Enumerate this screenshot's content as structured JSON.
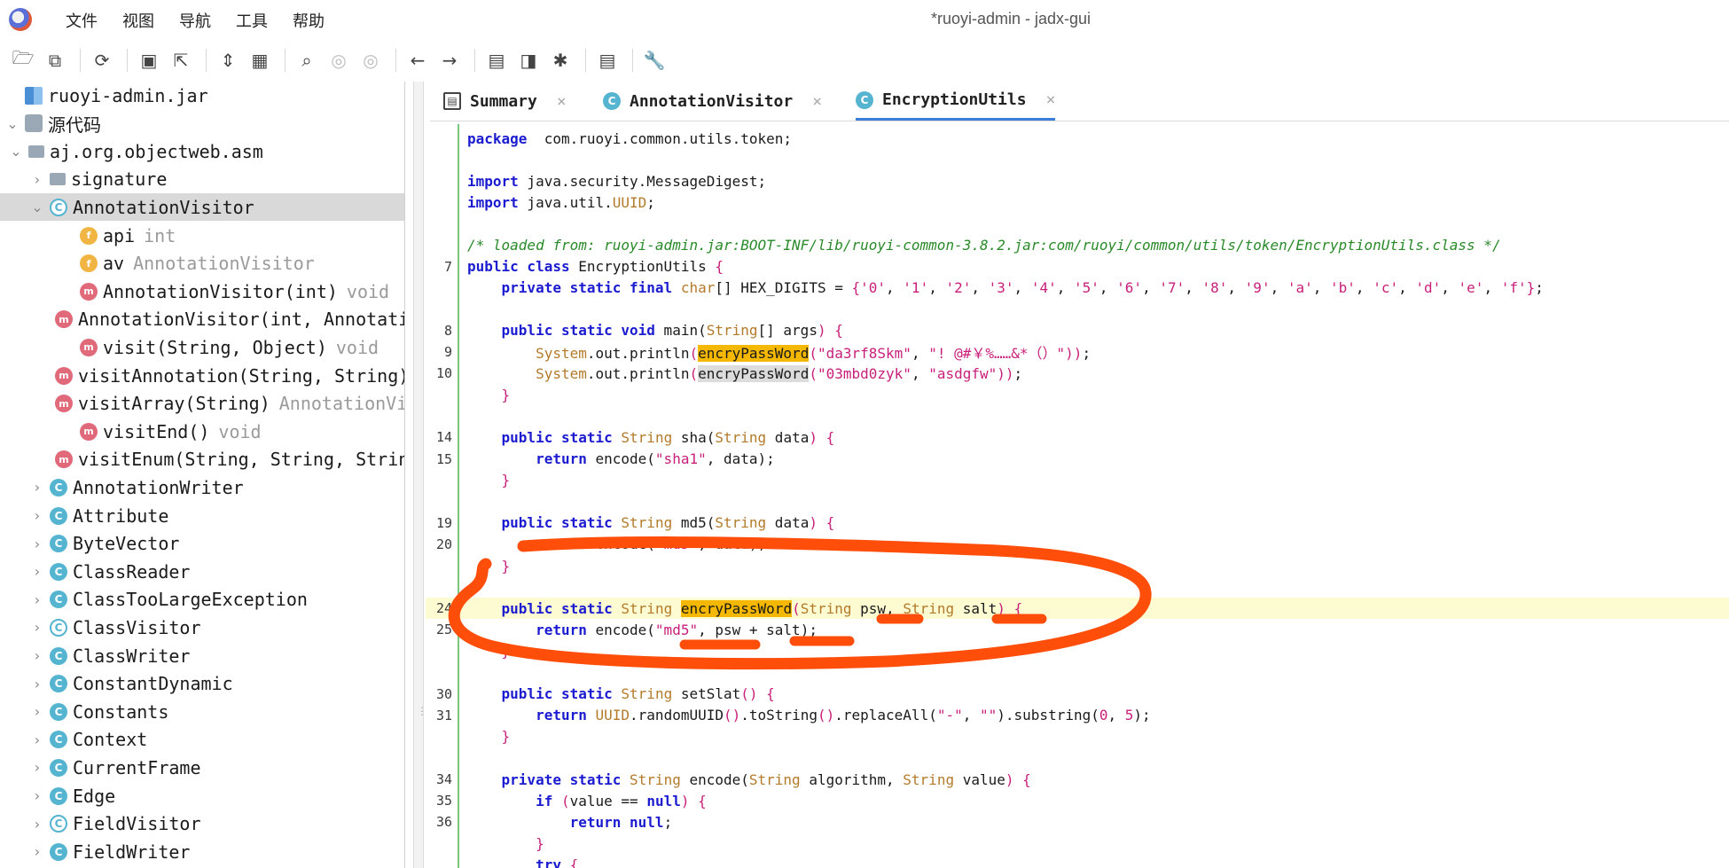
{
  "window": {
    "title": "*ruoyi-admin - jadx-gui"
  },
  "menu": [
    "文件",
    "视图",
    "导航",
    "工具",
    "帮助"
  ],
  "toolbar": [
    {
      "icon": "open-folder-icon",
      "g": "🗁"
    },
    {
      "icon": "add-files-icon",
      "g": "⧉"
    },
    {
      "sep": true
    },
    {
      "icon": "reload-icon",
      "g": "⟳"
    },
    {
      "sep": true
    },
    {
      "icon": "save-icon",
      "g": "▣"
    },
    {
      "icon": "export-icon",
      "g": "⇱"
    },
    {
      "sep": true
    },
    {
      "icon": "sync-tree-icon",
      "g": "⇕"
    },
    {
      "icon": "flatten-packages-icon",
      "g": "▦"
    },
    {
      "sep": true
    },
    {
      "icon": "search-icon",
      "g": "⌕"
    },
    {
      "icon": "find-class-icon",
      "g": "◎",
      "gray": true
    },
    {
      "icon": "find-usage-icon",
      "g": "◎",
      "gray": true
    },
    {
      "sep": true
    },
    {
      "icon": "back-icon",
      "g": "←"
    },
    {
      "icon": "forward-icon",
      "g": "→"
    },
    {
      "sep": true
    },
    {
      "icon": "decompile-all-icon",
      "g": "▤"
    },
    {
      "icon": "quark-icon",
      "g": "◨"
    },
    {
      "icon": "debug-icon",
      "g": "✱"
    },
    {
      "sep": true
    },
    {
      "icon": "log-viewer-icon",
      "g": "▤"
    },
    {
      "sep": true
    },
    {
      "icon": "settings-icon",
      "g": "🔧"
    }
  ],
  "tree": [
    {
      "depth": 0,
      "chev": "",
      "icon": "jar",
      "label": "ruoyi-admin.jar"
    },
    {
      "depth": 0,
      "chev": "v",
      "icon": "src",
      "label": "源代码"
    },
    {
      "depth": 1,
      "chev": "v",
      "icon": "pkg",
      "label": "aj.org.objectweb.asm"
    },
    {
      "depth": 2,
      "chev": ">",
      "icon": "pkg",
      "label": "signature"
    },
    {
      "depth": 2,
      "chev": "v",
      "icon": "class-abs",
      "label": "AnnotationVisitor",
      "selected": true
    },
    {
      "depth": 3,
      "chev": "",
      "icon": "field",
      "label": "api",
      "type": "int"
    },
    {
      "depth": 3,
      "chev": "",
      "icon": "field",
      "label": "av",
      "type": "AnnotationVisitor"
    },
    {
      "depth": 3,
      "chev": "",
      "icon": "method",
      "label": "AnnotationVisitor(int)",
      "type": "void"
    },
    {
      "depth": 3,
      "chev": "",
      "icon": "method",
      "label": "AnnotationVisitor(int, AnnotationVisitor)",
      "type": ""
    },
    {
      "depth": 3,
      "chev": "",
      "icon": "method",
      "label": "visit(String, Object)",
      "type": "void"
    },
    {
      "depth": 3,
      "chev": "",
      "icon": "method",
      "label": "visitAnnotation(String, String)",
      "type": ""
    },
    {
      "depth": 3,
      "chev": "",
      "icon": "method",
      "label": "visitArray(String)",
      "type": "AnnotationVisitor"
    },
    {
      "depth": 3,
      "chev": "",
      "icon": "method",
      "label": "visitEnd()",
      "type": "void"
    },
    {
      "depth": 3,
      "chev": "",
      "icon": "method",
      "label": "visitEnum(String, String, String)",
      "type": ""
    },
    {
      "depth": 2,
      "chev": ">",
      "icon": "class",
      "label": "AnnotationWriter"
    },
    {
      "depth": 2,
      "chev": ">",
      "icon": "class",
      "label": "Attribute"
    },
    {
      "depth": 2,
      "chev": ">",
      "icon": "class",
      "label": "ByteVector"
    },
    {
      "depth": 2,
      "chev": ">",
      "icon": "class",
      "label": "ClassReader"
    },
    {
      "depth": 2,
      "chev": ">",
      "icon": "class",
      "label": "ClassTooLargeException"
    },
    {
      "depth": 2,
      "chev": ">",
      "icon": "class-abs",
      "label": "ClassVisitor"
    },
    {
      "depth": 2,
      "chev": ">",
      "icon": "class",
      "label": "ClassWriter"
    },
    {
      "depth": 2,
      "chev": ">",
      "icon": "class",
      "label": "ConstantDynamic"
    },
    {
      "depth": 2,
      "chev": ">",
      "icon": "class",
      "label": "Constants"
    },
    {
      "depth": 2,
      "chev": ">",
      "icon": "class",
      "label": "Context"
    },
    {
      "depth": 2,
      "chev": ">",
      "icon": "class",
      "label": "CurrentFrame"
    },
    {
      "depth": 2,
      "chev": ">",
      "icon": "class",
      "label": "Edge"
    },
    {
      "depth": 2,
      "chev": ">",
      "icon": "class-abs",
      "label": "FieldVisitor"
    },
    {
      "depth": 2,
      "chev": ">",
      "icon": "class",
      "label": "FieldWriter"
    }
  ],
  "tabs": [
    {
      "label": "Summary",
      "icon": "summary",
      "active": false
    },
    {
      "label": "AnnotationVisitor",
      "icon": "class",
      "active": false
    },
    {
      "label": "EncryptionUtils",
      "icon": "class",
      "active": true
    }
  ],
  "code": [
    {
      "ln": "",
      "segs": [
        [
          "kw",
          "package"
        ],
        [
          "",
          "  com.ruoyi.common.utils.token;"
        ]
      ]
    },
    {
      "ln": "",
      "segs": []
    },
    {
      "ln": "",
      "segs": [
        [
          "kw",
          "import"
        ],
        [
          "",
          " java.security.MessageDigest;"
        ]
      ]
    },
    {
      "ln": "",
      "segs": [
        [
          "kw",
          "import"
        ],
        [
          "",
          " java.util."
        ],
        [
          "ty",
          "UUID"
        ],
        [
          "",
          ";"
        ]
      ]
    },
    {
      "ln": "",
      "segs": []
    },
    {
      "ln": "",
      "segs": [
        [
          "cmt",
          "/* loaded from: ruoyi-admin.jar:BOOT-INF/lib/ruoyi-common-3.8.2.jar:com/ruoyi/common/utils/token/EncryptionUtils.class */"
        ]
      ]
    },
    {
      "ln": "7",
      "segs": [
        [
          "kw",
          "public class"
        ],
        [
          "",
          " EncryptionUtils "
        ],
        [
          "pn",
          "{"
        ]
      ]
    },
    {
      "ln": "",
      "segs": [
        [
          "",
          "    "
        ],
        [
          "kw",
          "private static final"
        ],
        [
          "",
          " "
        ],
        [
          "ty",
          "char"
        ],
        [
          "",
          "[] HEX_DIGITS = "
        ],
        [
          "pn",
          "{"
        ],
        [
          "str",
          "'0'"
        ],
        [
          ", ",
          ", "
        ],
        [
          "str",
          "'1'"
        ],
        [
          "",
          ", "
        ],
        [
          "str",
          "'2'"
        ],
        [
          "",
          ", "
        ],
        [
          "str",
          "'3'"
        ],
        [
          "",
          ", "
        ],
        [
          "str",
          "'4'"
        ],
        [
          "",
          ", "
        ],
        [
          "str",
          "'5'"
        ],
        [
          "",
          ", "
        ],
        [
          "str",
          "'6'"
        ],
        [
          "",
          ", "
        ],
        [
          "str",
          "'7'"
        ],
        [
          "",
          ", "
        ],
        [
          "str",
          "'8'"
        ],
        [
          "",
          ", "
        ],
        [
          "str",
          "'9'"
        ],
        [
          "",
          ", "
        ],
        [
          "str",
          "'a'"
        ],
        [
          "",
          ", "
        ],
        [
          "str",
          "'b'"
        ],
        [
          "",
          ", "
        ],
        [
          "str",
          "'c'"
        ],
        [
          "",
          ", "
        ],
        [
          "str",
          "'d'"
        ],
        [
          "",
          ", "
        ],
        [
          "str",
          "'e'"
        ],
        [
          "",
          ", "
        ],
        [
          "str",
          "'f'"
        ],
        [
          "pn",
          "}"
        ],
        [
          "",
          ";"
        ]
      ]
    },
    {
      "ln": "",
      "segs": []
    },
    {
      "ln": "8",
      "segs": [
        [
          "",
          "    "
        ],
        [
          "kw",
          "public static void"
        ],
        [
          "",
          " main("
        ],
        [
          "ty",
          "String"
        ],
        [
          "",
          "[] args"
        ],
        [
          "pn",
          ")"
        ],
        [
          "",
          " "
        ],
        [
          "pn",
          "{"
        ]
      ]
    },
    {
      "ln": "9",
      "segs": [
        [
          "",
          "        "
        ],
        [
          "ty",
          "System"
        ],
        [
          "",
          ".out.println"
        ],
        [
          "pn",
          "("
        ],
        [
          "mark",
          "encryPassWord"
        ],
        [
          "pn",
          "("
        ],
        [
          "str",
          "\"da3rf8Skm\""
        ],
        [
          "",
          ", "
        ],
        [
          "str",
          "\"! @#￥%……&*（）\""
        ],
        [
          "pn",
          "))"
        ],
        [
          "",
          ";"
        ]
      ]
    },
    {
      "ln": "10",
      "segs": [
        [
          "",
          "        "
        ],
        [
          "ty",
          "System"
        ],
        [
          "",
          ".out.println"
        ],
        [
          "pn",
          "("
        ],
        [
          "mark2",
          "encryPassWord"
        ],
        [
          "pn",
          "("
        ],
        [
          "str",
          "\"03mbd0zyk\""
        ],
        [
          "",
          ", "
        ],
        [
          "str",
          "\"asdgfw\""
        ],
        [
          "pn",
          "))"
        ],
        [
          "",
          ";"
        ]
      ]
    },
    {
      "ln": "",
      "segs": [
        [
          "",
          "    "
        ],
        [
          "pn",
          "}"
        ]
      ]
    },
    {
      "ln": "",
      "segs": []
    },
    {
      "ln": "14",
      "segs": [
        [
          "",
          "    "
        ],
        [
          "kw",
          "public static"
        ],
        [
          "",
          " "
        ],
        [
          "ty",
          "String"
        ],
        [
          "",
          " sha("
        ],
        [
          "ty",
          "String"
        ],
        [
          "",
          " data"
        ],
        [
          "pn",
          ")"
        ],
        [
          "",
          " "
        ],
        [
          "pn",
          "{"
        ]
      ]
    },
    {
      "ln": "15",
      "segs": [
        [
          "",
          "        "
        ],
        [
          "kw",
          "return"
        ],
        [
          "",
          " encode("
        ],
        [
          "str",
          "\"sha1\""
        ],
        [
          "",
          ", data);"
        ]
      ]
    },
    {
      "ln": "",
      "segs": [
        [
          "",
          "    "
        ],
        [
          "pn",
          "}"
        ]
      ]
    },
    {
      "ln": "",
      "segs": []
    },
    {
      "ln": "19",
      "segs": [
        [
          "",
          "    "
        ],
        [
          "kw",
          "public static"
        ],
        [
          "",
          " "
        ],
        [
          "ty",
          "String"
        ],
        [
          "",
          " md5("
        ],
        [
          "ty",
          "String"
        ],
        [
          "",
          " data"
        ],
        [
          "pn",
          ")"
        ],
        [
          "",
          " "
        ],
        [
          "pn",
          "{"
        ]
      ]
    },
    {
      "ln": "20",
      "segs": [
        [
          "",
          "        "
        ],
        [
          "kw",
          "return"
        ],
        [
          "",
          " encode("
        ],
        [
          "str",
          "\"md5\""
        ],
        [
          "",
          ", data);"
        ]
      ]
    },
    {
      "ln": "",
      "segs": [
        [
          "",
          "    "
        ],
        [
          "pn",
          "}"
        ]
      ]
    },
    {
      "ln": "",
      "segs": []
    },
    {
      "ln": "24",
      "hl": true,
      "segs": [
        [
          "",
          "    "
        ],
        [
          "kw",
          "public static"
        ],
        [
          "",
          " "
        ],
        [
          "ty",
          "String"
        ],
        [
          "",
          " "
        ],
        [
          "mark",
          "encryPassWord"
        ],
        [
          "pn",
          "("
        ],
        [
          "ty",
          "String"
        ],
        [
          "",
          " psw, "
        ],
        [
          "ty",
          "String"
        ],
        [
          "",
          " salt"
        ],
        [
          "pn",
          ")"
        ],
        [
          "",
          " "
        ],
        [
          "pn",
          "{"
        ]
      ]
    },
    {
      "ln": "25",
      "segs": [
        [
          "",
          "        "
        ],
        [
          "kw",
          "return"
        ],
        [
          "",
          " encode("
        ],
        [
          "str",
          "\"md5\""
        ],
        [
          "",
          ", psw + salt);"
        ]
      ]
    },
    {
      "ln": "",
      "segs": [
        [
          "",
          "    "
        ],
        [
          "pn",
          "}"
        ]
      ]
    },
    {
      "ln": "",
      "segs": []
    },
    {
      "ln": "30",
      "segs": [
        [
          "",
          "    "
        ],
        [
          "kw",
          "public static"
        ],
        [
          "",
          " "
        ],
        [
          "ty",
          "String"
        ],
        [
          "",
          " setSlat"
        ],
        [
          "pn",
          "()"
        ],
        [
          "",
          " "
        ],
        [
          "pn",
          "{"
        ]
      ]
    },
    {
      "ln": "31",
      "segs": [
        [
          "",
          "        "
        ],
        [
          "kw",
          "return"
        ],
        [
          "",
          " "
        ],
        [
          "ty",
          "UUID"
        ],
        [
          "",
          ".randomUUID"
        ],
        [
          "pn",
          "()"
        ],
        [
          "",
          ".toString"
        ],
        [
          "pn",
          "()"
        ],
        [
          "",
          ".replaceAll("
        ],
        [
          "str",
          "\"-\""
        ],
        [
          "",
          ", "
        ],
        [
          "str",
          "\"\""
        ],
        [
          "",
          ").substring("
        ],
        [
          "num",
          "0"
        ],
        [
          "",
          ", "
        ],
        [
          "num",
          "5"
        ],
        [
          "",
          ");"
        ]
      ]
    },
    {
      "ln": "",
      "segs": [
        [
          "",
          "    "
        ],
        [
          "pn",
          "}"
        ]
      ]
    },
    {
      "ln": "",
      "segs": []
    },
    {
      "ln": "34",
      "segs": [
        [
          "",
          "    "
        ],
        [
          "kw",
          "private static"
        ],
        [
          "",
          " "
        ],
        [
          "ty",
          "String"
        ],
        [
          "",
          " encode("
        ],
        [
          "ty",
          "String"
        ],
        [
          "",
          " algorithm, "
        ],
        [
          "ty",
          "String"
        ],
        [
          "",
          " value"
        ],
        [
          "pn",
          ")"
        ],
        [
          "",
          " "
        ],
        [
          "pn",
          "{"
        ]
      ]
    },
    {
      "ln": "35",
      "segs": [
        [
          "",
          "        "
        ],
        [
          "kw",
          "if"
        ],
        [
          "",
          " "
        ],
        [
          "pn",
          "("
        ],
        [
          "",
          "value == "
        ],
        [
          "kw",
          "null"
        ],
        [
          "pn",
          ")"
        ],
        [
          "",
          " "
        ],
        [
          "pn",
          "{"
        ]
      ]
    },
    {
      "ln": "36",
      "segs": [
        [
          "",
          "            "
        ],
        [
          "kw",
          "return null"
        ],
        [
          "",
          ";"
        ]
      ]
    },
    {
      "ln": "",
      "segs": [
        [
          "",
          "        "
        ],
        [
          "pn",
          "}"
        ]
      ]
    },
    {
      "ln": "",
      "segs": [
        [
          "",
          "        "
        ],
        [
          "kw",
          "try"
        ],
        [
          "",
          " "
        ],
        [
          "pn",
          "{"
        ]
      ]
    }
  ],
  "colors": {
    "accent": "#3d7fd8",
    "annotation": "#ff4d0a",
    "highlight_line": "#fdfbd2",
    "search_mark": "#f5b800"
  }
}
